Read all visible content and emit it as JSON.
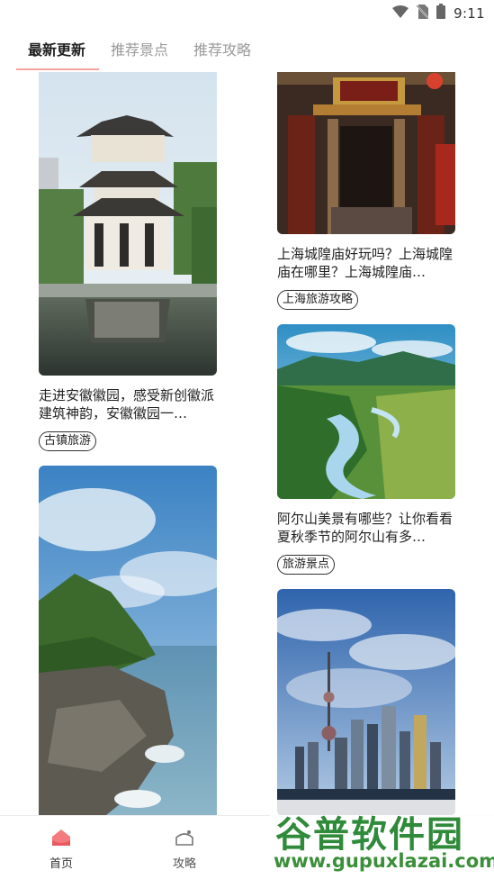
{
  "status_bar": {
    "time": "9:11",
    "icons": [
      "wifi-icon",
      "no-sim-icon",
      "battery-icon"
    ]
  },
  "tabs": [
    {
      "label": "最新更新",
      "active": true
    },
    {
      "label": "推荐景点",
      "active": false
    },
    {
      "label": "推荐攻略",
      "active": false
    }
  ],
  "feed": {
    "left": [
      {
        "title": "走进安徽徽园，感受新创徽派建筑神韵，安徽徽园一…",
        "tag": "古镇旅游",
        "image": "pavilion-reflection-photo"
      },
      {
        "title": "",
        "tag": "",
        "image": "rocky-coast-photo"
      }
    ],
    "right": [
      {
        "title": "上海城隍庙好玩吗？上海城隍庙在哪里？上海城隍庙…",
        "tag": "上海旅游攻略",
        "image": "temple-gate-photo"
      },
      {
        "title": "阿尔山美景有哪些？让你看看夏秋季节的阿尔山有多…",
        "tag": "旅游景点",
        "image": "valley-lake-photo"
      },
      {
        "title": "",
        "tag": "",
        "image": "shanghai-skyline-photo"
      }
    ]
  },
  "bottom_nav": [
    {
      "label": "首页",
      "icon": "home-icon",
      "active": true
    },
    {
      "label": "攻略",
      "icon": "guide-icon",
      "active": false
    }
  ],
  "colors": {
    "accent": "#f47a7e",
    "underline": "#f4a39e",
    "tab_inactive": "#9a9a9a",
    "watermark_green": "#2f8a3a"
  },
  "watermark": {
    "logo_text": "谷普软件园",
    "url": "www.gupuxlazai.com"
  }
}
